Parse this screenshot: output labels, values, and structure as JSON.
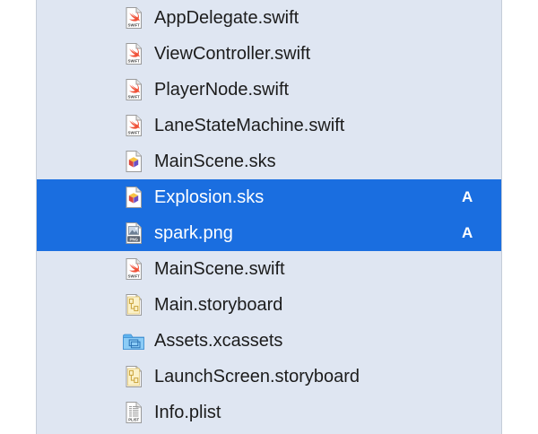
{
  "navigator": {
    "files": [
      {
        "name": "AppDelegate.swift",
        "icon": "swift-file-icon",
        "badge": "SWIFT",
        "status": "",
        "selected": false
      },
      {
        "name": "ViewController.swift",
        "icon": "swift-file-icon",
        "badge": "SWIFT",
        "status": "",
        "selected": false
      },
      {
        "name": "PlayerNode.swift",
        "icon": "swift-file-icon",
        "badge": "SWIFT",
        "status": "",
        "selected": false
      },
      {
        "name": "LaneStateMachine.swift",
        "icon": "swift-file-icon",
        "badge": "SWIFT",
        "status": "",
        "selected": false
      },
      {
        "name": "MainScene.sks",
        "icon": "spritekit-scene-icon",
        "status": "",
        "selected": false
      },
      {
        "name": "Explosion.sks",
        "icon": "spritekit-scene-icon",
        "status": "A",
        "selected": true
      },
      {
        "name": "spark.png",
        "icon": "png-image-icon",
        "badge": "PNG",
        "status": "A",
        "selected": true
      },
      {
        "name": "MainScene.swift",
        "icon": "swift-file-icon",
        "badge": "SWIFT",
        "status": "",
        "selected": false
      },
      {
        "name": "Main.storyboard",
        "icon": "storyboard-icon",
        "status": "",
        "selected": false
      },
      {
        "name": "Assets.xcassets",
        "icon": "asset-catalog-folder-icon",
        "status": "",
        "selected": false
      },
      {
        "name": "LaunchScreen.storyboard",
        "icon": "storyboard-icon",
        "status": "",
        "selected": false
      },
      {
        "name": "Info.plist",
        "icon": "plist-file-icon",
        "badge": "PLIST",
        "status": "",
        "selected": false
      }
    ]
  },
  "colors": {
    "navigator_bg": "#dfe6f2",
    "selection": "#1a6ee0",
    "swift_orange": "#f05138",
    "folder_blue": "#5fb3ef"
  }
}
